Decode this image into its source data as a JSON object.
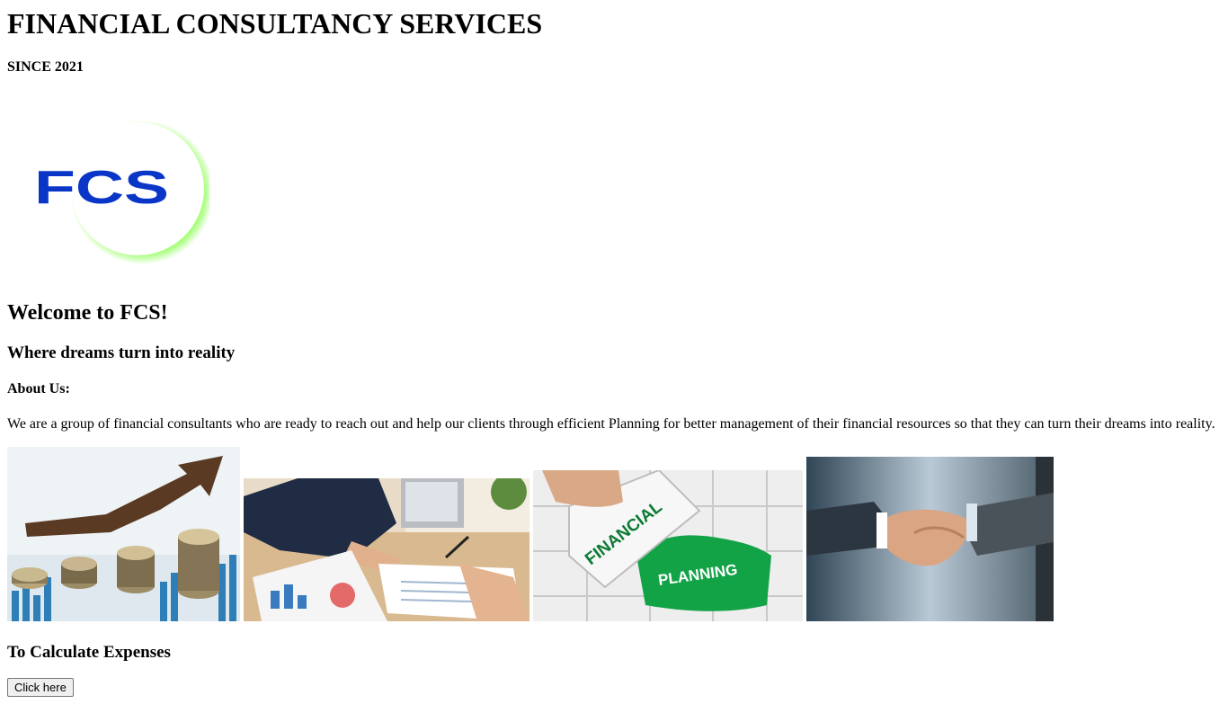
{
  "header": {
    "title": "FINANCIAL CONSULTANCY SERVICES",
    "since": "SINCE 2021"
  },
  "logo": {
    "text": "FCS",
    "colors": {
      "text": "#0a36c8",
      "glow": "#7dff3c"
    }
  },
  "main": {
    "welcome": "Welcome to FCS!",
    "tagline": "Where dreams turn into reality",
    "about_heading": "About Us:",
    "about_text": "We are a group of financial consultants who are ready to reach out and help our clients through efficient Planning for better management of their financial resources so that they can turn their dreams into reality."
  },
  "images": {
    "puzzle_word_1": "FINANCIAL",
    "puzzle_word_2": "PLANNING"
  },
  "calculator": {
    "heading": "To Calculate Expenses",
    "button_label": "Click here"
  }
}
